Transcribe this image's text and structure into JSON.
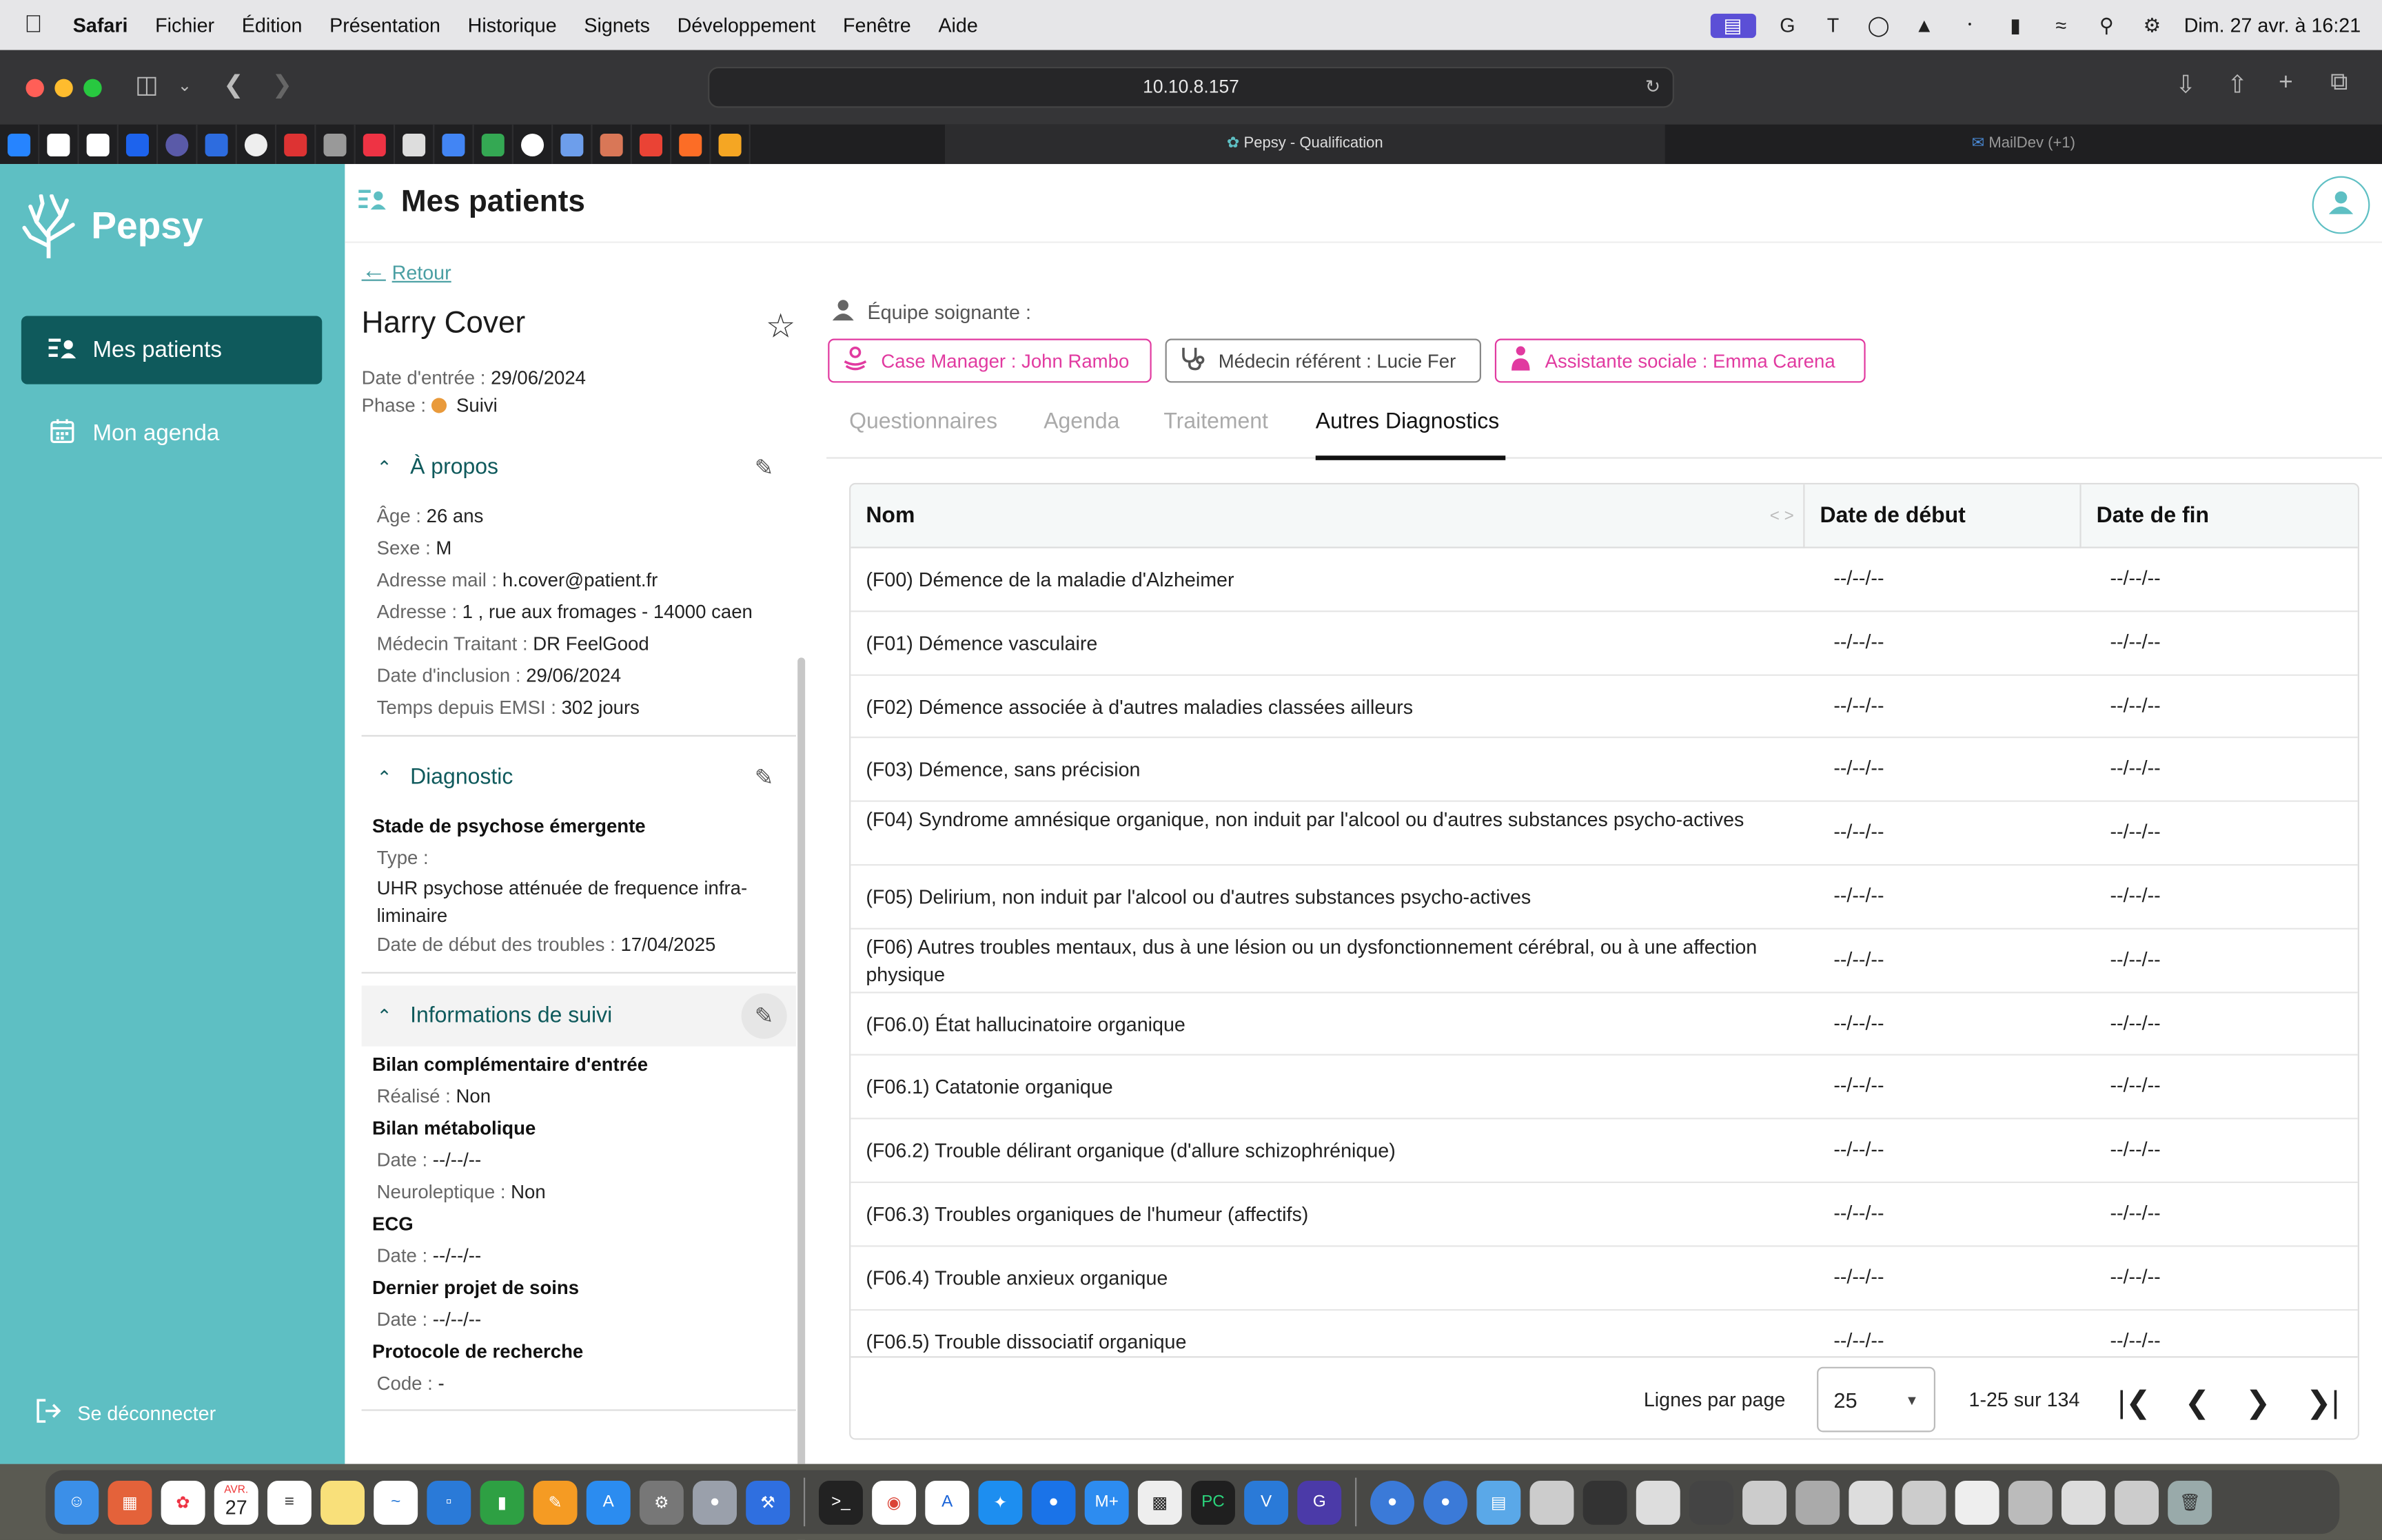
{
  "menubar": {
    "app_name": "Safari",
    "items": [
      "Fichier",
      "Édition",
      "Présentation",
      "Historique",
      "Signets",
      "Développement",
      "Fenêtre",
      "Aide"
    ],
    "datetime": "Dim. 27 avr. à 16:21"
  },
  "browser": {
    "url": "10.10.8.157",
    "tabs": [
      {
        "title": "Pepsy - Qualification"
      },
      {
        "title": "MailDev (+1)"
      }
    ]
  },
  "sidebar": {
    "logo_text": "Pepsy",
    "nav": [
      {
        "label": "Mes patients",
        "icon": "patient-list-icon",
        "active": true
      },
      {
        "label": "Mon agenda",
        "icon": "calendar-icon",
        "active": false
      }
    ],
    "logout_label": "Se déconnecter"
  },
  "header": {
    "title": "Mes patients"
  },
  "patient": {
    "back_label": "Retour",
    "name": "Harry Cover",
    "entry_label": "Date d'entrée : ",
    "entry_date": "29/06/2024",
    "phase_label": "Phase : ",
    "phase_value": "Suivi",
    "phase_color": "#e99a3b"
  },
  "about": {
    "title": "À propos",
    "fields": [
      {
        "label": "Âge : ",
        "value": "26 ans"
      },
      {
        "label": "Sexe : ",
        "value": "M"
      },
      {
        "label": "Adresse mail : ",
        "value": "h.cover@patient.fr"
      },
      {
        "label": "Adresse : ",
        "value": "1 , rue aux fromages - 14000 caen"
      },
      {
        "label": "Médecin Traitant : ",
        "value": "DR FeelGood"
      },
      {
        "label": "Date d'inclusion : ",
        "value": "29/06/2024"
      },
      {
        "label": "Temps depuis EMSI : ",
        "value": "302 jours"
      }
    ]
  },
  "diagnostic": {
    "title": "Diagnostic",
    "stage": "Stade de psychose émergente",
    "type_label": "Type :",
    "type_value": "UHR psychose atténuée de frequence infra-liminaire",
    "start_label": "Date de début des troubles : ",
    "start_value": "17/04/2025"
  },
  "followup": {
    "title": "Informations de suivi",
    "blocks": [
      {
        "heading": "Bilan complémentaire d'entrée",
        "rows": [
          {
            "label": "Réalisé : ",
            "value": "Non"
          }
        ]
      },
      {
        "heading": "Bilan métabolique",
        "rows": [
          {
            "label": "Date : ",
            "value": "--/--/--"
          },
          {
            "label": "Neuroleptique : ",
            "value": "Non"
          }
        ]
      },
      {
        "heading": "ECG",
        "rows": [
          {
            "label": "Date : ",
            "value": "--/--/--"
          }
        ]
      },
      {
        "heading": "Dernier projet de soins",
        "rows": [
          {
            "label": "Date : ",
            "value": "--/--/--"
          }
        ]
      },
      {
        "heading": "Protocole de recherche",
        "rows": [
          {
            "label": "Code : ",
            "value": "-"
          }
        ]
      }
    ]
  },
  "team": {
    "label": "Équipe soignante :",
    "members": [
      {
        "label": "Case Manager : John Rambo"
      },
      {
        "label": "Médecin référent : Lucie Fer"
      },
      {
        "label": "Assistante sociale : Emma Carena"
      }
    ]
  },
  "tabs": [
    "Questionnaires",
    "Agenda",
    "Traitement",
    "Autres Diagnostics"
  ],
  "table": {
    "columns": [
      "Nom",
      "Date de début",
      "Date de fin"
    ],
    "rows": [
      {
        "name": "(F00) Démence de la maladie d'Alzheimer",
        "start": "--/--/--",
        "end": "--/--/--"
      },
      {
        "name": "(F01) Démence vasculaire",
        "start": "--/--/--",
        "end": "--/--/--"
      },
      {
        "name": "(F02) Démence associée à d'autres maladies classées ailleurs",
        "start": "--/--/--",
        "end": "--/--/--"
      },
      {
        "name": "(F03) Démence, sans précision",
        "start": "--/--/--",
        "end": "--/--/--"
      },
      {
        "name": "(F04) Syndrome amnésique organique, non induit par l'alcool ou d'autres substances psycho-actives",
        "start": "--/--/--",
        "end": "--/--/--"
      },
      {
        "name": "(F05) Delirium, non induit par l'alcool ou d'autres substances psycho-actives",
        "start": "--/--/--",
        "end": "--/--/--"
      },
      {
        "name": "(F06) Autres troubles mentaux, dus à une lésion ou un dysfonctionnement cérébral, ou à une affection physique",
        "start": "--/--/--",
        "end": "--/--/--"
      },
      {
        "name": "(F06.0) État hallucinatoire organique",
        "start": "--/--/--",
        "end": "--/--/--"
      },
      {
        "name": "(F06.1) Catatonie organique",
        "start": "--/--/--",
        "end": "--/--/--"
      },
      {
        "name": "(F06.2) Trouble délirant organique (d'allure schizophrénique)",
        "start": "--/--/--",
        "end": "--/--/--"
      },
      {
        "name": "(F06.3) Troubles organiques de l'humeur (affectifs)",
        "start": "--/--/--",
        "end": "--/--/--"
      },
      {
        "name": "(F06.4) Trouble anxieux organique",
        "start": "--/--/--",
        "end": "--/--/--"
      },
      {
        "name": "(F06.5) Trouble dissociatif organique",
        "start": "--/--/--",
        "end": "--/--/--"
      }
    ],
    "pagination": {
      "rows_per_page_label": "Lignes par page",
      "rows_per_page": "25",
      "range": "1-25 sur 134"
    }
  },
  "dock": {
    "calendar_month": "AVR.",
    "calendar_day": "27"
  },
  "colors": {
    "sidebar": "#5ebfc3",
    "active_nav": "#0f5a5c",
    "accent_pink": "#e13aa0"
  }
}
